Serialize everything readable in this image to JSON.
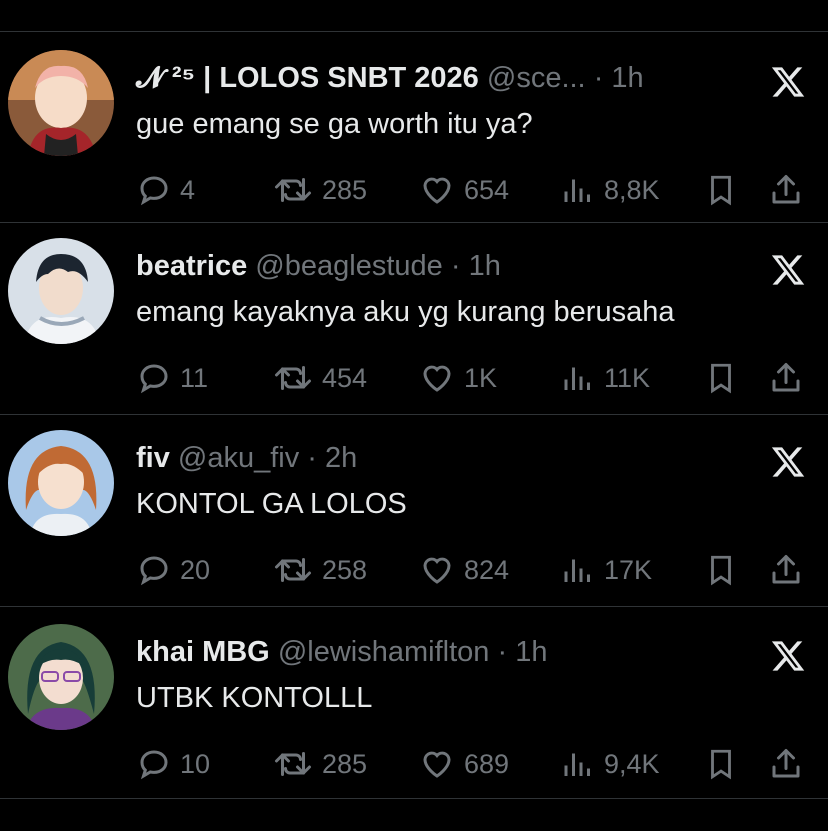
{
  "tweets": [
    {
      "name": "𝓝 ²⁵ | LOLOS SNBT 2026",
      "handle": "@sce...",
      "time": "1h",
      "text": "gue emang se ga worth itu ya?",
      "replies": "4",
      "retweets": "285",
      "likes": "654",
      "views": "8,8K"
    },
    {
      "name": "beatrice",
      "handle": "@beaglestude",
      "time": "1h",
      "text": "emang kayaknya aku yg kurang berusaha",
      "replies": "11",
      "retweets": "454",
      "likes": "1K",
      "views": "11K"
    },
    {
      "name": "fiv",
      "handle": "@aku_fiv",
      "time": "2h",
      "text": "KONTOL GA LOLOS",
      "replies": "20",
      "retweets": "258",
      "likes": "824",
      "views": "17K"
    },
    {
      "name": "khai MBG",
      "handle": "@lewishamiflton",
      "time": "1h",
      "text": "UTBK KONTOLLL",
      "replies": "10",
      "retweets": "285",
      "likes": "689",
      "views": "9,4K"
    }
  ],
  "dot": "·",
  "colors": {
    "background": "#000000",
    "text": "#e7e9ea",
    "muted": "#71767b",
    "separator": "#2f3336"
  }
}
